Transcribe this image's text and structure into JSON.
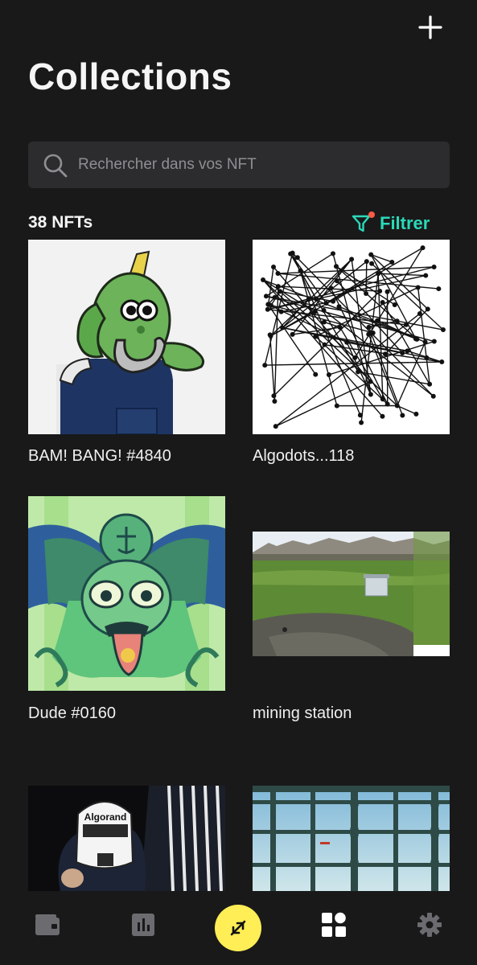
{
  "header": {
    "title": "Collections",
    "add_icon": "plus-icon"
  },
  "search": {
    "placeholder": "Rechercher dans vos NFT",
    "value": ""
  },
  "summary": {
    "count_label": "38 NFTs",
    "filter_label": "Filtrer",
    "filter_icon": "funnel-icon",
    "accent_color": "#2bd9b8",
    "badge_color": "#ff5a46"
  },
  "nfts": [
    {
      "name": "BAM! BANG! #4840"
    },
    {
      "name": "Algodots...118"
    },
    {
      "name": "Dude #0160"
    },
    {
      "name": "mining station"
    },
    {
      "name": "",
      "image_text": "Algorand"
    },
    {
      "name": ""
    }
  ],
  "tabbar": {
    "items": [
      {
        "icon": "wallet-icon"
      },
      {
        "icon": "chart-icon"
      },
      {
        "icon": "swap-icon",
        "color": "#ffee55"
      },
      {
        "icon": "collectibles-icon",
        "active": true
      },
      {
        "icon": "settings-icon"
      }
    ]
  }
}
